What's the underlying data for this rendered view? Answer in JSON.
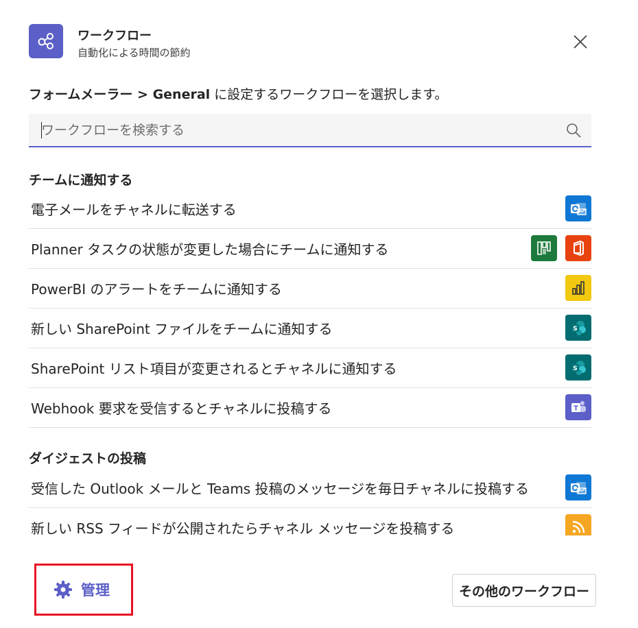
{
  "header": {
    "title": "ワークフロー",
    "subtitle": "自動化による時間の節約"
  },
  "intro": {
    "prefix": "フォームメーラー > General",
    "suffix": " に設定するワークフローを選択します。"
  },
  "search": {
    "placeholder": "ワークフローを検索する"
  },
  "sections": [
    {
      "title": "チームに通知する",
      "items": [
        {
          "label": "電子メールをチャネルに転送する",
          "icons": [
            "outlook-icon"
          ]
        },
        {
          "label": "Planner タスクの状態が変更した場合にチームに通知する",
          "icons": [
            "planner-icon",
            "office-icon"
          ]
        },
        {
          "label": "PowerBI のアラートをチームに通知する",
          "icons": [
            "powerbi-icon"
          ]
        },
        {
          "label": "新しい SharePoint ファイルをチームに通知する",
          "icons": [
            "sharepoint-icon"
          ]
        },
        {
          "label": "SharePoint リスト項目が変更されるとチャネルに通知する",
          "icons": [
            "sharepoint-icon"
          ]
        },
        {
          "label": "Webhook 要求を受信するとチャネルに投稿する",
          "icons": [
            "teams-icon"
          ]
        }
      ]
    },
    {
      "title": "ダイジェストの投稿",
      "items": [
        {
          "label": "受信した Outlook メールと Teams 投稿のメッセージを毎日チャネルに投稿する",
          "icons": [
            "outlook-icon"
          ]
        },
        {
          "label": "新しい RSS フィードが公開されたらチャネル メッセージを投稿する",
          "icons": [
            "rss-icon"
          ]
        }
      ]
    }
  ],
  "footer": {
    "manage_label": "管理",
    "more_label": "その他のワークフロー"
  },
  "colors": {
    "accent": "#5b5fc7",
    "highlight_border": "#e81123",
    "outlook": "#0f78d4",
    "planner": "#1e7a3c",
    "office": "#e8430f",
    "powerbi": "#f2c811",
    "sharepoint": "#036c70",
    "teams": "#5b5fc7",
    "rss": "#f5a623"
  }
}
